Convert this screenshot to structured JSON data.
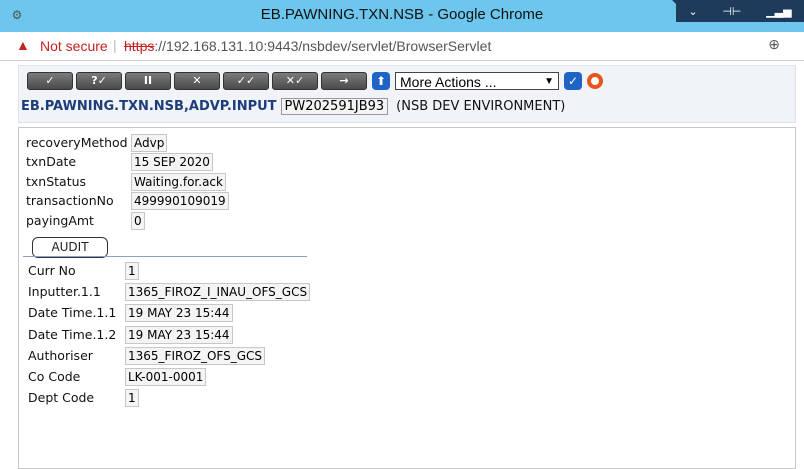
{
  "window": {
    "title": "EB.PAWNING.TXN.NSB - Google Chrome",
    "controls": [
      "⌄",
      "⊣⊢",
      "▁▃▅"
    ]
  },
  "addressbar": {
    "security_label": "Not secure",
    "url_scheme": "https",
    "url_rest": "://192.168.131.10:9443/nsbdev/servlet/BrowserServlet"
  },
  "toolbar": {
    "buttons": [
      "✓",
      "?✓",
      "II",
      "✕",
      "✓✓",
      "✕✓",
      "→"
    ],
    "more_actions": "More Actions ...",
    "version_name": "EB.PAWNING.TXN.NSB,ADVP.INPUT",
    "record_id": "PW202591JB93",
    "environment": "(NSB DEV ENVIRONMENT)"
  },
  "fields": [
    {
      "label": "recoveryMethod",
      "value": "Advp"
    },
    {
      "label": "txnDate",
      "value": "15 SEP 2020"
    },
    {
      "label": "txnStatus",
      "value": "Waiting.for.ack"
    },
    {
      "label": "transactionNo",
      "value": "499990109019"
    },
    {
      "label": "payingAmt",
      "value": "0"
    }
  ],
  "audit": {
    "tab_label": "AUDIT",
    "rows": [
      {
        "label": "Curr No",
        "value": "1"
      },
      {
        "label": "Inputter.1.1",
        "value": "1365_FIROZ_I_INAU_OFS_GCS"
      },
      {
        "label": "Date Time.1.1",
        "value": "19 MAY 23 15:44"
      },
      {
        "label": "Date Time.1.2",
        "value": "19 MAY 23 15:44"
      },
      {
        "label": "Authoriser",
        "value": "1365_FIROZ_OFS_GCS"
      },
      {
        "label": "Co Code",
        "value": "LK-001-0001"
      },
      {
        "label": "Dept Code",
        "value": "1"
      }
    ]
  }
}
